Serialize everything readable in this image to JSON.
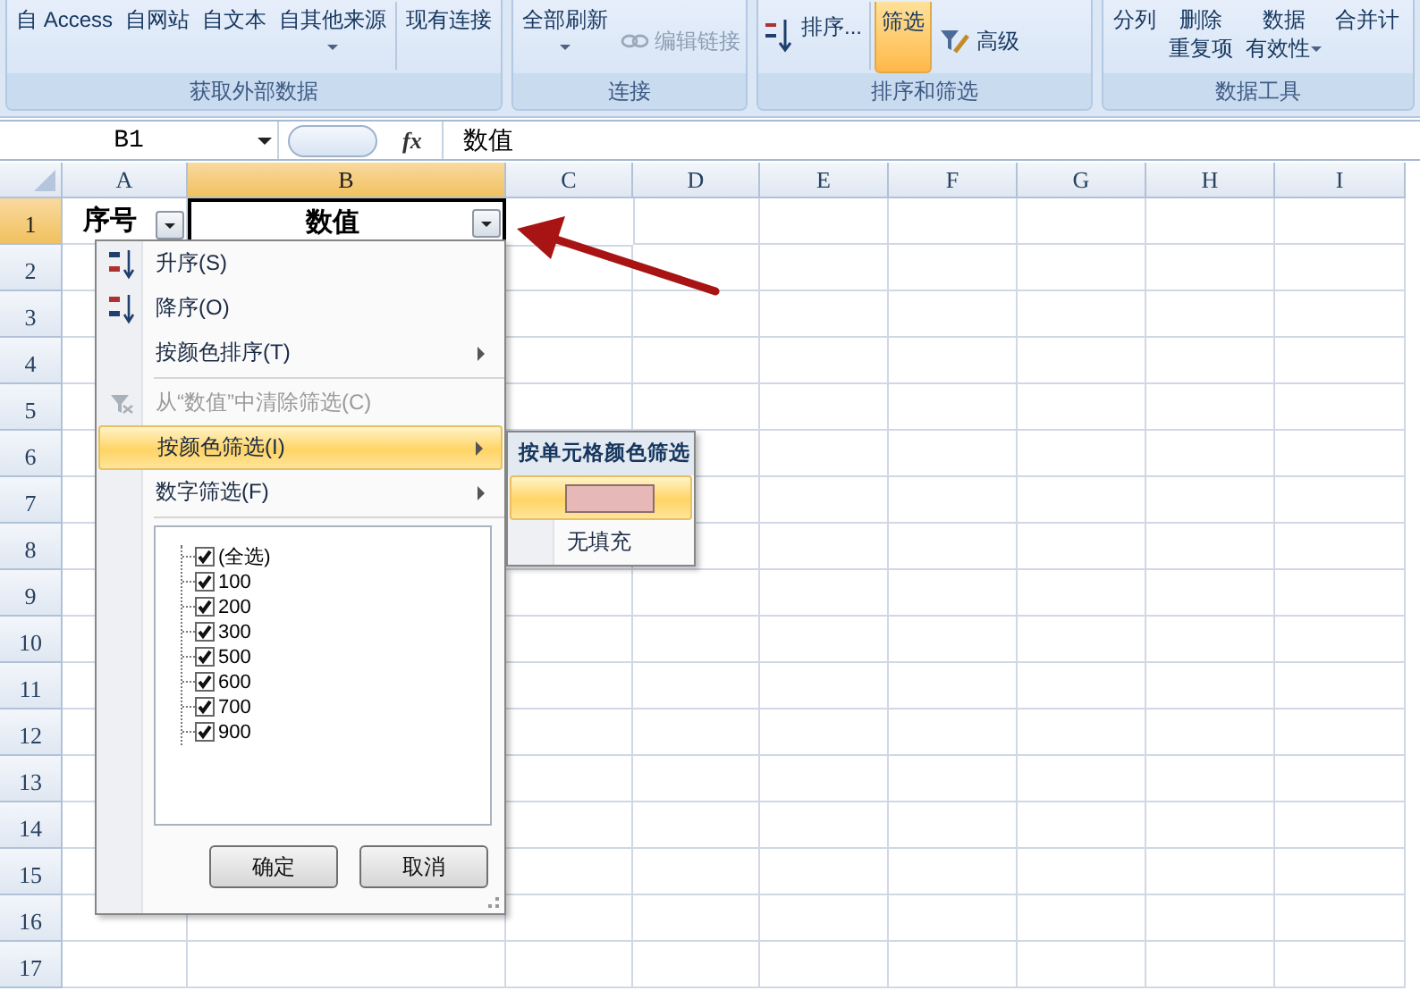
{
  "ribbon": {
    "groups": [
      {
        "label": "获取外部数据",
        "buttons": [
          {
            "kind": "plain",
            "lines": [
              "自 Access"
            ],
            "on": false,
            "disabled": false,
            "dropdown": false
          },
          {
            "kind": "plain",
            "lines": [
              "自网站"
            ],
            "on": false,
            "disabled": false,
            "dropdown": false
          },
          {
            "kind": "plain",
            "lines": [
              "自文本"
            ],
            "on": false,
            "disabled": false,
            "dropdown": false
          },
          {
            "kind": "plain",
            "lines": [
              "自其他来源"
            ],
            "on": false,
            "disabled": false,
            "dropdown": true
          },
          {
            "kind": "divider"
          },
          {
            "kind": "plain",
            "lines": [
              "现有连接"
            ],
            "on": false,
            "disabled": false,
            "dropdown": false
          }
        ]
      },
      {
        "label": "连接",
        "buttons": [
          {
            "kind": "plain",
            "lines": [
              "全部刷新"
            ],
            "on": false,
            "disabled": false,
            "dropdown": true
          },
          {
            "kind": "link",
            "lines": [
              "编辑链接"
            ],
            "on": false,
            "disabled": true,
            "dropdown": false
          }
        ]
      },
      {
        "label": "排序和筛选",
        "buttons": [
          {
            "kind": "sort",
            "lines": [
              "排序..."
            ],
            "on": false,
            "disabled": false,
            "dropdown": false
          },
          {
            "kind": "divider"
          },
          {
            "kind": "plain",
            "lines": [
              "筛选"
            ],
            "on": true,
            "disabled": false,
            "dropdown": false
          },
          {
            "kind": "advanced",
            "lines": [
              "高级"
            ],
            "on": false,
            "disabled": false,
            "dropdown": false
          }
        ]
      },
      {
        "label": "数据工具",
        "buttons": [
          {
            "kind": "plain",
            "lines": [
              "分列"
            ],
            "on": false,
            "disabled": false,
            "dropdown": false
          },
          {
            "kind": "plain",
            "lines": [
              "删除",
              "重复项"
            ],
            "on": false,
            "disabled": false,
            "dropdown": false
          },
          {
            "kind": "plain",
            "lines": [
              "数据",
              "有效性"
            ],
            "on": false,
            "disabled": false,
            "dropdown": true
          },
          {
            "kind": "plain",
            "lines": [
              "合并计"
            ],
            "on": false,
            "disabled": false,
            "dropdown": false
          }
        ]
      }
    ]
  },
  "formula_bar": {
    "name_box": "B1",
    "fx": "fx",
    "value": "数值"
  },
  "sheet": {
    "columns": [
      {
        "label": "A",
        "selected": false
      },
      {
        "label": "B",
        "selected": true
      },
      {
        "label": "C",
        "selected": false
      },
      {
        "label": "D",
        "selected": false
      },
      {
        "label": "E",
        "selected": false
      },
      {
        "label": "F",
        "selected": false
      },
      {
        "label": "G",
        "selected": false
      },
      {
        "label": "H",
        "selected": false
      },
      {
        "label": "I",
        "selected": false
      }
    ],
    "rows": [
      {
        "header": "1",
        "selected": true,
        "cells": [
          {
            "text": "序号",
            "filter": true,
            "active": false
          },
          {
            "text": "数值",
            "filter": true,
            "active": true
          }
        ]
      },
      {
        "header": "2",
        "selected": false,
        "cells": []
      },
      {
        "header": "3",
        "selected": false,
        "cells": []
      },
      {
        "header": "4",
        "selected": false,
        "cells": []
      },
      {
        "header": "5",
        "selected": false,
        "cells": []
      },
      {
        "header": "6",
        "selected": false,
        "cells": []
      },
      {
        "header": "7",
        "selected": false,
        "cells": []
      },
      {
        "header": "8",
        "selected": false,
        "cells": []
      },
      {
        "header": "9",
        "selected": false,
        "cells": []
      },
      {
        "header": "10",
        "selected": false,
        "cells": []
      },
      {
        "header": "11",
        "selected": false,
        "cells": []
      },
      {
        "header": "12",
        "selected": false,
        "cells": []
      },
      {
        "header": "13",
        "selected": false,
        "cells": []
      },
      {
        "header": "14",
        "selected": false,
        "cells": []
      },
      {
        "header": "15",
        "selected": false,
        "cells": []
      },
      {
        "header": "16",
        "selected": false,
        "cells": []
      },
      {
        "header": "17",
        "selected": false,
        "cells": []
      }
    ]
  },
  "filter_menu": {
    "items": [
      {
        "kind": "sort-asc",
        "label": "升序(S)",
        "disabled": false,
        "selected": false,
        "submenu": false
      },
      {
        "kind": "sort-desc",
        "label": "降序(O)",
        "disabled": false,
        "selected": false,
        "submenu": false
      },
      {
        "kind": "command",
        "label": "按颜色排序(T)",
        "disabled": false,
        "selected": false,
        "submenu": true
      },
      {
        "kind": "separator"
      },
      {
        "kind": "clear-filter",
        "label": "从“数值”中清除筛选(C)",
        "disabled": true,
        "selected": false,
        "submenu": false
      },
      {
        "kind": "command",
        "label": "按颜色筛选(I)",
        "disabled": false,
        "selected": true,
        "submenu": true
      },
      {
        "kind": "command",
        "label": "数字筛选(F)",
        "disabled": false,
        "selected": false,
        "submenu": true
      },
      {
        "kind": "separator"
      }
    ],
    "values": [
      {
        "label": "(全选)",
        "checked": true
      },
      {
        "label": "100",
        "checked": true
      },
      {
        "label": "200",
        "checked": true
      },
      {
        "label": "300",
        "checked": true
      },
      {
        "label": "500",
        "checked": true
      },
      {
        "label": "600",
        "checked": true
      },
      {
        "label": "700",
        "checked": true
      },
      {
        "label": "900",
        "checked": true
      }
    ],
    "buttons": [
      "确定",
      "取消"
    ]
  },
  "color_submenu": {
    "heading": "按单元格颜色筛选",
    "items": [
      {
        "kind": "swatch",
        "color": "#e6b8b7",
        "selected": true
      },
      {
        "kind": "text",
        "label": "无填充",
        "selected": false
      }
    ]
  }
}
